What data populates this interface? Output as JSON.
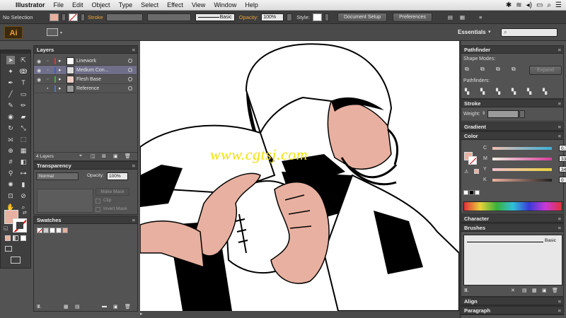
{
  "menubar": {
    "app_name": "Illustrator",
    "menus": [
      "File",
      "Edit",
      "Object",
      "Type",
      "Select",
      "Effect",
      "View",
      "Window",
      "Help"
    ]
  },
  "controlbar": {
    "selection": "No Selection",
    "stroke_label": "Stroke",
    "brush_label": "Basic",
    "opacity_label": "Opacity:",
    "opacity_value": "100%",
    "style_label": "Style:",
    "document_setup": "Document Setup",
    "preferences": "Preferences"
  },
  "appbar": {
    "logo": "Ai",
    "workspace": "Essentials",
    "search_placeholder": ""
  },
  "layers": {
    "title": "Layers",
    "rows": [
      {
        "name": "Linework",
        "color": "#d33c3c",
        "selected": false
      },
      {
        "name": "Medium Con...",
        "color": "#3c5fd3",
        "selected": true
      },
      {
        "name": "Flesh Base",
        "color": "#3cb33c",
        "selected": false
      },
      {
        "name": "Reference",
        "color": "#4a73d8",
        "selected": false
      }
    ],
    "count": "4 Layers"
  },
  "transparency": {
    "title": "Transparency",
    "blend_mode": "Normal",
    "opacity_label": "Opacity:",
    "opacity_value": "100%",
    "make_mask": "Make Mask",
    "clip": "Clip",
    "invert_mask": "Invert Mask"
  },
  "swatches": {
    "title": "Swatches"
  },
  "pathfinder": {
    "title": "Pathfinder",
    "shape_modes": "Shape Modes:",
    "expand": "Expand",
    "pathfinders": "Pathfinders:"
  },
  "stroke_panel": {
    "title": "Stroke",
    "weight_label": "Weight:"
  },
  "gradient_panel": {
    "title": "Gradient"
  },
  "color_panel": {
    "title": "Color",
    "channels": [
      {
        "label": "C",
        "value": "0.78",
        "color": "#3ab0d8"
      },
      {
        "label": "M",
        "value": "33.72",
        "color": "#d83a9a"
      },
      {
        "label": "Y",
        "value": "34.12",
        "color": "#e8d23a"
      },
      {
        "label": "K",
        "value": "0",
        "color": "#888888"
      }
    ],
    "fill_color": "#e8b0a0"
  },
  "character_panel": {
    "title": "Character"
  },
  "brushes_panel": {
    "title": "Brushes",
    "brush_name": "Basic"
  },
  "align_panel": {
    "title": "Align"
  },
  "paragraph_panel": {
    "title": "Paragraph"
  },
  "watermark": "www.cgtsj.com",
  "colors": {
    "accent": "#e8a33d",
    "skin": "#e8b0a0",
    "panel": "#535353"
  }
}
